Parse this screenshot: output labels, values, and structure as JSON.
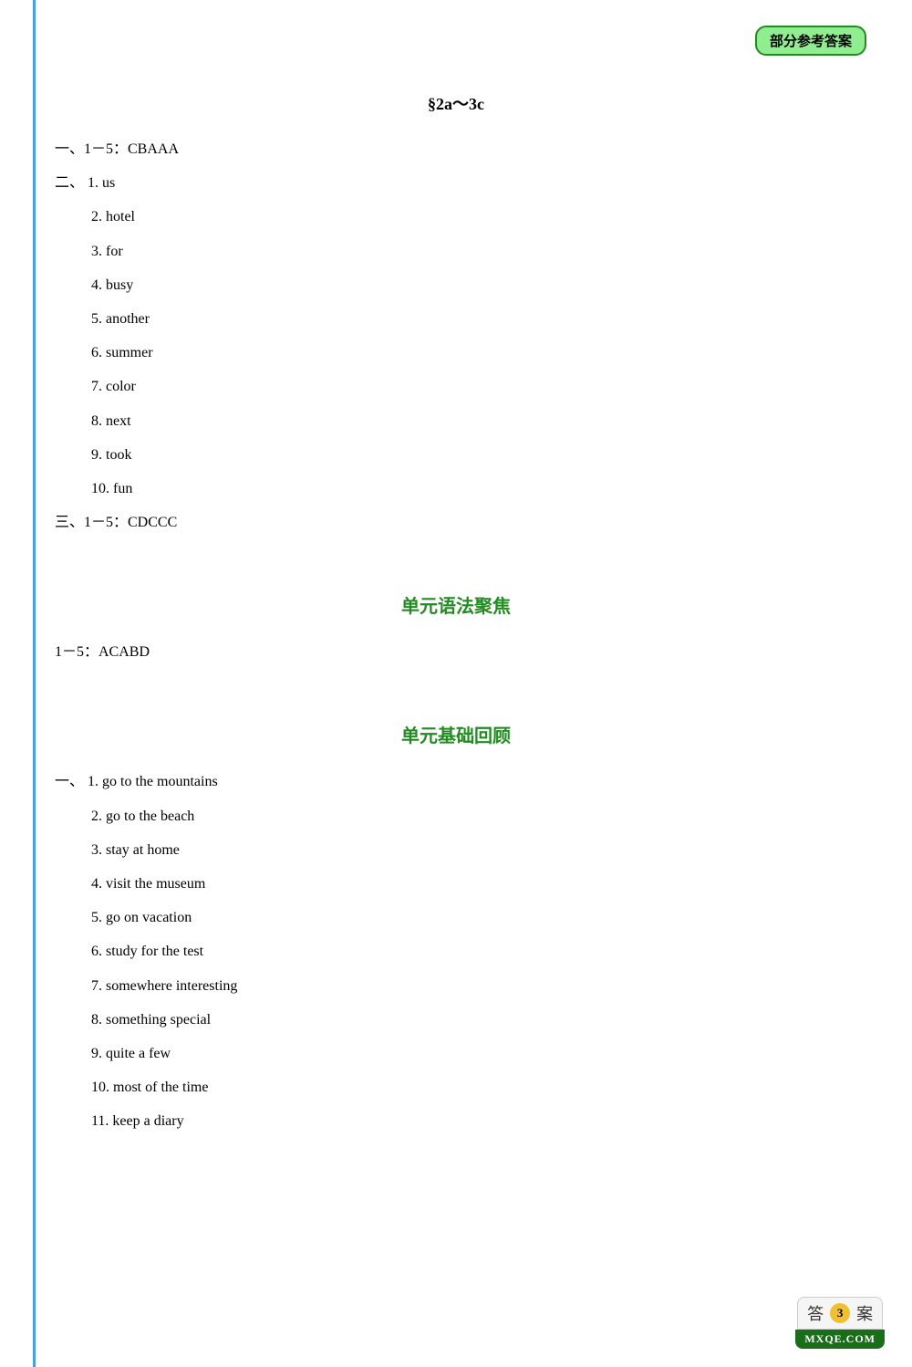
{
  "badge": {
    "label": "部分参考答案"
  },
  "section1": {
    "title": "§2a～3c",
    "part1": {
      "label": "一、1－5：CBAAA"
    },
    "part2": {
      "label": "二、",
      "items": [
        "1. us",
        "2. hotel",
        "3. for",
        "4. busy",
        "5. another",
        "6. summer",
        "7. color",
        "8. next",
        "9. took",
        "10. fun"
      ]
    },
    "part3": {
      "label": "三、1－5：CDCCC"
    }
  },
  "section2": {
    "title": "单元语法聚焦",
    "part1": {
      "label": "1－5：ACABD"
    }
  },
  "section3": {
    "title": "单元基础回顾",
    "part1": {
      "label": "一、",
      "items": [
        "1. go to the mountains",
        "2. go to the beach",
        "3. stay at home",
        "4. visit the museum",
        "5. go on vacation",
        "6. study for the test",
        "7. somewhere interesting",
        "8. something special",
        "9. quite a few",
        "10. most of the time",
        "11. keep a diary"
      ]
    }
  },
  "logo": {
    "top": "答案",
    "page": "3",
    "bottom": "MXQE.COM"
  }
}
